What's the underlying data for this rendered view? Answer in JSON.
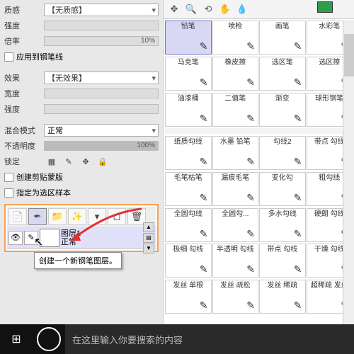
{
  "left": {
    "texture": {
      "label": "质感",
      "value": "【无质感】"
    },
    "intensity": {
      "label": "强度"
    },
    "ratio": {
      "label": "倍率",
      "pct": "10%"
    },
    "applyPen": "应用到钢笔线",
    "effect": {
      "label": "效果",
      "value": "【无效果】"
    },
    "width": {
      "label": "宽度"
    },
    "intensity2": {
      "label": "强度"
    },
    "blend": {
      "label": "混合模式",
      "value": "正常"
    },
    "opacity": {
      "label": "不透明度",
      "pct": "100%"
    },
    "lock": {
      "label": "锁定"
    },
    "clip": "创建剪贴蒙版",
    "sample": "指定为选区样本",
    "tooltip": "创建一个新钢笔图层。",
    "layer": {
      "name": "图层1",
      "mode": "正常"
    }
  },
  "brushes": [
    {
      "n": "铅笔",
      "sel": true
    },
    {
      "n": "喷枪"
    },
    {
      "n": "画笔"
    },
    {
      "n": "水彩笔"
    },
    {
      "n": "马克笔"
    },
    {
      "n": "橡皮擦"
    },
    {
      "n": "选区笔"
    },
    {
      "n": "选区擦"
    },
    {
      "n": "油漆桶"
    },
    {
      "n": "二值笔"
    },
    {
      "n": "渐变"
    },
    {
      "n": "球形钢笔"
    },
    {
      "gap": true
    },
    {
      "n": "纸质勾线"
    },
    {
      "n": "水墨\n铅笔"
    },
    {
      "n": "勾线2"
    },
    {
      "n": "带点\n勾线"
    },
    {
      "n": "毛笔枯笔"
    },
    {
      "n": "漏痕毛笔"
    },
    {
      "n": "变化勾"
    },
    {
      "n": "粗勾线"
    },
    {
      "n": "全圆勾线"
    },
    {
      "n": "全圆勾..."
    },
    {
      "n": "多水勾线"
    },
    {
      "n": "硬朗\n勾线"
    },
    {
      "n": "极细\n勾线"
    },
    {
      "n": "半透明\n勾线"
    },
    {
      "n": "带点\n勾线"
    },
    {
      "n": "干燥\n勾线"
    },
    {
      "n": "发丝\n单根"
    },
    {
      "n": "发丝\n疏松"
    },
    {
      "n": "发丝\n稀疏"
    },
    {
      "n": "超稀疏\n发丝"
    }
  ],
  "taskbar": {
    "search": "在这里输入你要搜索的内容"
  }
}
